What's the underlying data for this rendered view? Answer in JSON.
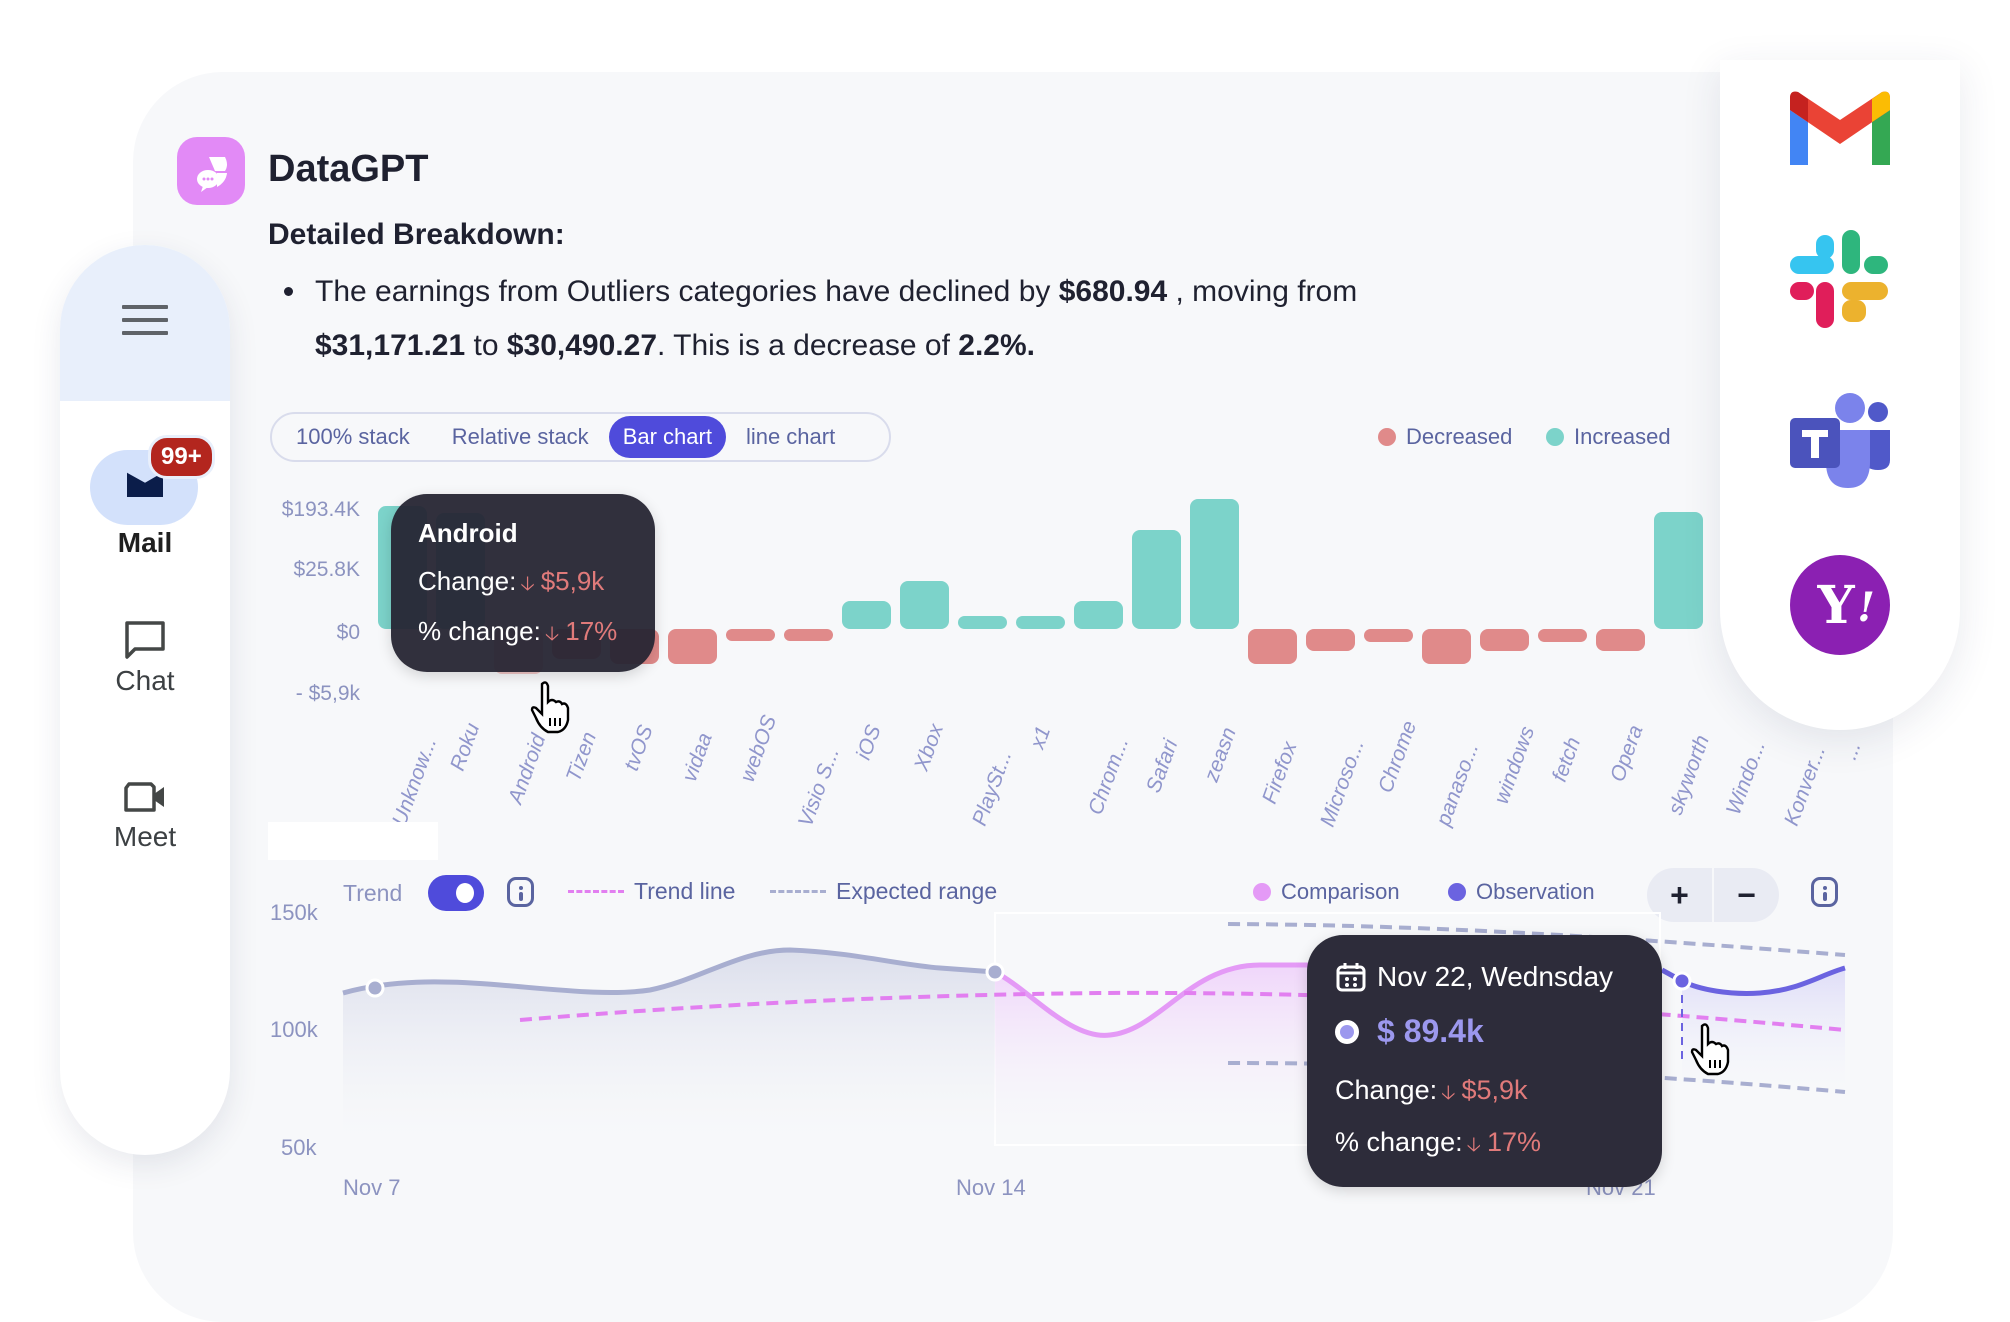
{
  "app": {
    "name": "DataGPT",
    "logo_icon": "datagpt-chat-logo",
    "accent_color": "#e28af6"
  },
  "message": {
    "heading": "Detailed Breakdown:",
    "bullet": {
      "t1": "The earnings from Outliers categories have declined by ",
      "b1": "$680.94",
      "t2": " , moving from ",
      "b2": "$31,171.21",
      "t3": " to ",
      "b3": "$30,490.27",
      "t4": ". This is a decrease of ",
      "b4": "2.2%."
    }
  },
  "chart_tabs": [
    {
      "label": "100% stack",
      "active": false
    },
    {
      "label": "Relative stack",
      "active": false
    },
    {
      "label": "Bar chart",
      "active": true
    },
    {
      "label": "line chart",
      "active": false
    }
  ],
  "bar_legend": {
    "decreased": {
      "label": "Decreased",
      "color": "#e08a8a"
    },
    "increased": {
      "label": "Increased",
      "color": "#7cd3ca"
    }
  },
  "bar_tooltip": {
    "title": "Android",
    "change_label": "Change:",
    "change_value": "$5,9k",
    "pct_label": "% change:",
    "pct_value": "17%",
    "direction": "down"
  },
  "sidebar": {
    "menu_icon": "hamburger-menu-icon",
    "items": [
      {
        "label": "Mail",
        "icon": "mail-icon",
        "badge": "99+",
        "active": true
      },
      {
        "label": "Chat",
        "icon": "chat-icon",
        "active": false
      },
      {
        "label": "Meet",
        "icon": "video-camera-icon",
        "active": false
      }
    ]
  },
  "integrations": [
    {
      "name": "Gmail",
      "icon": "gmail-icon"
    },
    {
      "name": "Slack",
      "icon": "slack-icon"
    },
    {
      "name": "Microsoft Teams",
      "icon": "teams-icon"
    },
    {
      "name": "Yahoo",
      "icon": "yahoo-icon"
    }
  ],
  "line_controls": {
    "trend_label": "Trend",
    "trend_enabled": true,
    "trend_line_label": "Trend line",
    "expected_range_label": "Expected range",
    "comparison_label": "Comparison",
    "observation_label": "Observation",
    "zoom_in": "+",
    "zoom_out": "−",
    "colors": {
      "comparison": "#e49af6",
      "observation": "#6b63e0",
      "trend": "#e27ff0",
      "expected": "#a8aed0"
    }
  },
  "line_tooltip": {
    "date": "Nov 22, Wednsday",
    "value": "$ 89.4k",
    "change_label": "Change:",
    "change_value": "$5,9k",
    "pct_label": "% change:",
    "pct_value": "17%"
  },
  "chart_data": [
    {
      "type": "bar",
      "title": "",
      "y_tick_labels": [
        "$193.4K",
        "$25.8K",
        "$0",
        "- $5,9k"
      ],
      "categories": [
        "Unknow...",
        "Roku",
        "Android",
        "Tizen",
        "tvOS",
        "vidaa",
        "webOS",
        "Visio S...",
        "iOS",
        "Xbox",
        "PlaySt...",
        "x1",
        "Chrom...",
        "Safari",
        "zeasn",
        "Firefox",
        "Microso...",
        "Chrome",
        "panaso...",
        "windows",
        "fetch",
        "Opera",
        "skyworth",
        "Windo...",
        "Konver...",
        "..."
      ],
      "values_relative": [
        0.85,
        0.8,
        -0.45,
        -0.3,
        -0.35,
        -0.35,
        -0.08,
        -0.05,
        0.19,
        0.33,
        0.09,
        0.09,
        0.19,
        0.68,
        0.9,
        -0.35,
        -0.22,
        -0.13,
        -0.35,
        -0.22,
        -0.13,
        -0.22,
        0.81,
        0.67,
        0,
        0
      ],
      "value_note": "relative bar heights; positive scale normalized to $193.4K tick, negative to -$5,9k tick",
      "highlighted": "Android",
      "legend": [
        "Decreased",
        "Increased"
      ],
      "legend_position": "top-right"
    },
    {
      "type": "line",
      "x_tick_labels": [
        "Nov 7",
        "Nov 14",
        "Nov 21"
      ],
      "y_tick_labels": [
        "150k",
        "100k",
        "50k"
      ],
      "ylim": [
        50000,
        150000
      ],
      "series": [
        {
          "name": "Comparison (past)",
          "x": [
            0,
            0.5,
            1,
            2,
            3,
            3.5,
            4,
            5,
            6,
            6.5,
            7
          ],
          "y": [
            118000,
            120000,
            121000,
            119000,
            118000,
            126000,
            135000,
            129000,
            126000,
            126000,
            126000
          ]
        },
        {
          "name": "Comparison",
          "x": [
            7,
            8,
            9,
            10,
            11,
            12
          ],
          "y": [
            126000,
            100000,
            126000,
            126000,
            126000,
            126000
          ]
        },
        {
          "name": "Observation",
          "x": [
            14,
            15,
            16,
            17
          ],
          "y": [
            122000,
            118000,
            115000,
            127000
          ]
        },
        {
          "name": "Trend line",
          "x": [
            1.7,
            7,
            12,
            17
          ],
          "y": [
            104000,
            112000,
            114000,
            105000
          ]
        },
        {
          "name": "Expected range upper",
          "x": [
            10,
            14,
            17
          ],
          "y": [
            145000,
            142000,
            138000
          ]
        },
        {
          "name": "Expected range lower",
          "x": [
            10,
            14,
            17
          ],
          "y": [
            91000,
            88000,
            84000
          ]
        }
      ],
      "tooltip_point": {
        "date": "Nov 22",
        "value": 89400
      }
    }
  ]
}
